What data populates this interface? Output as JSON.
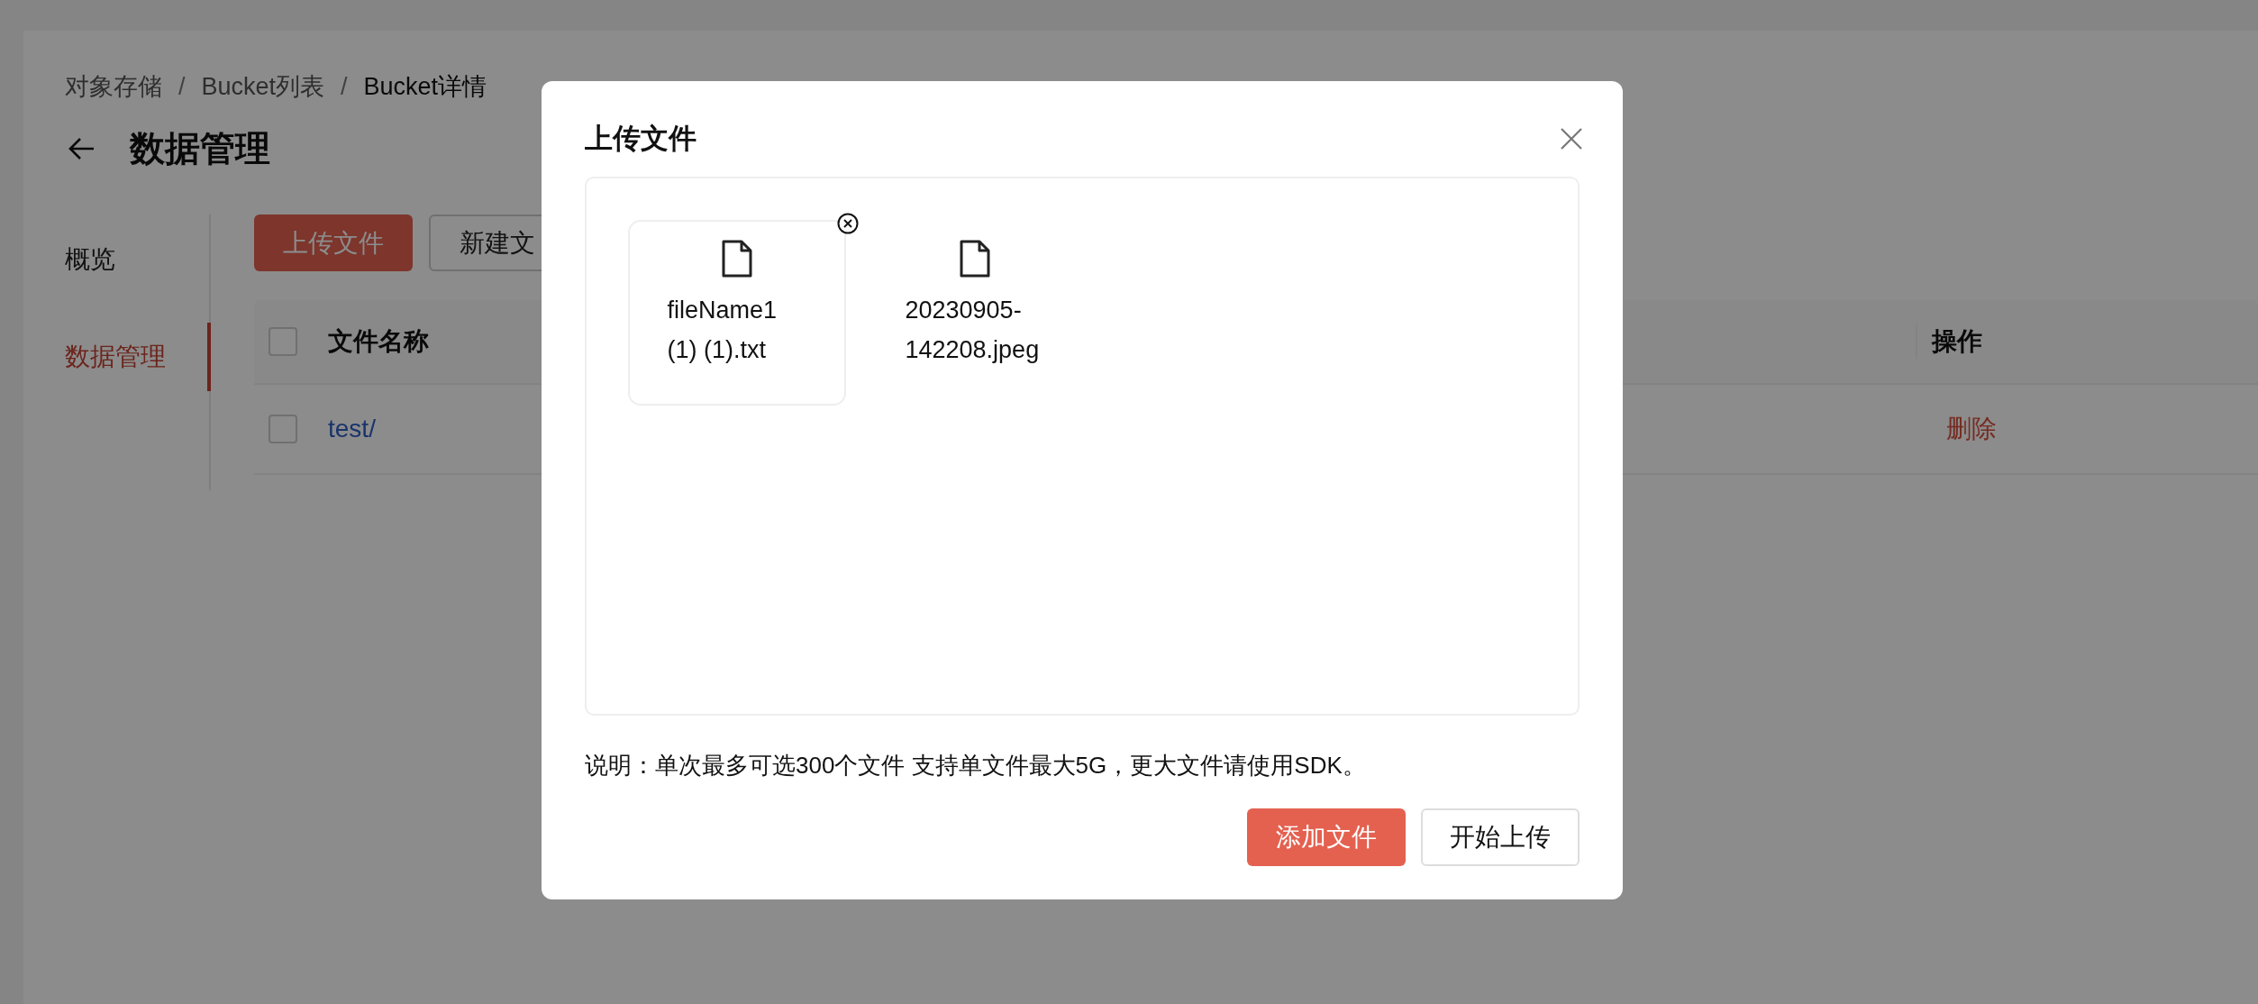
{
  "breadcrumb": [
    {
      "label": "对象存储",
      "current": false
    },
    {
      "label": "Bucket列表",
      "current": false,
      "separator": "/"
    },
    {
      "label": "Bucket详情",
      "current": true,
      "separator": "/"
    }
  ],
  "page_title": "数据管理",
  "sidebar": {
    "items": [
      {
        "label": "概览",
        "selected": false
      },
      {
        "label": "数据管理",
        "selected": true
      }
    ]
  },
  "toolbar": {
    "buttons": [
      {
        "label": "上传文件",
        "kind": "primary"
      },
      {
        "label": "新建文",
        "kind": "default"
      }
    ]
  },
  "table": {
    "header_checked": false,
    "columns": [
      "文件名称",
      "操作"
    ],
    "rows": [
      {
        "name": "test/",
        "checked": false,
        "action": "删除"
      }
    ]
  },
  "dialog": {
    "title": "上传文件",
    "files": [
      {
        "name": "fileName1 (1) (1).txt",
        "selected": true
      },
      {
        "name": "20230905-142208.jpeg",
        "selected": false
      }
    ],
    "note": "说明：单次最多可选300个文件 支持单文件最大5G，更大文件请使用SDK。",
    "buttons": [
      {
        "label": "添加文件",
        "kind": "primary"
      },
      {
        "label": "开始上传",
        "kind": "default"
      }
    ]
  }
}
